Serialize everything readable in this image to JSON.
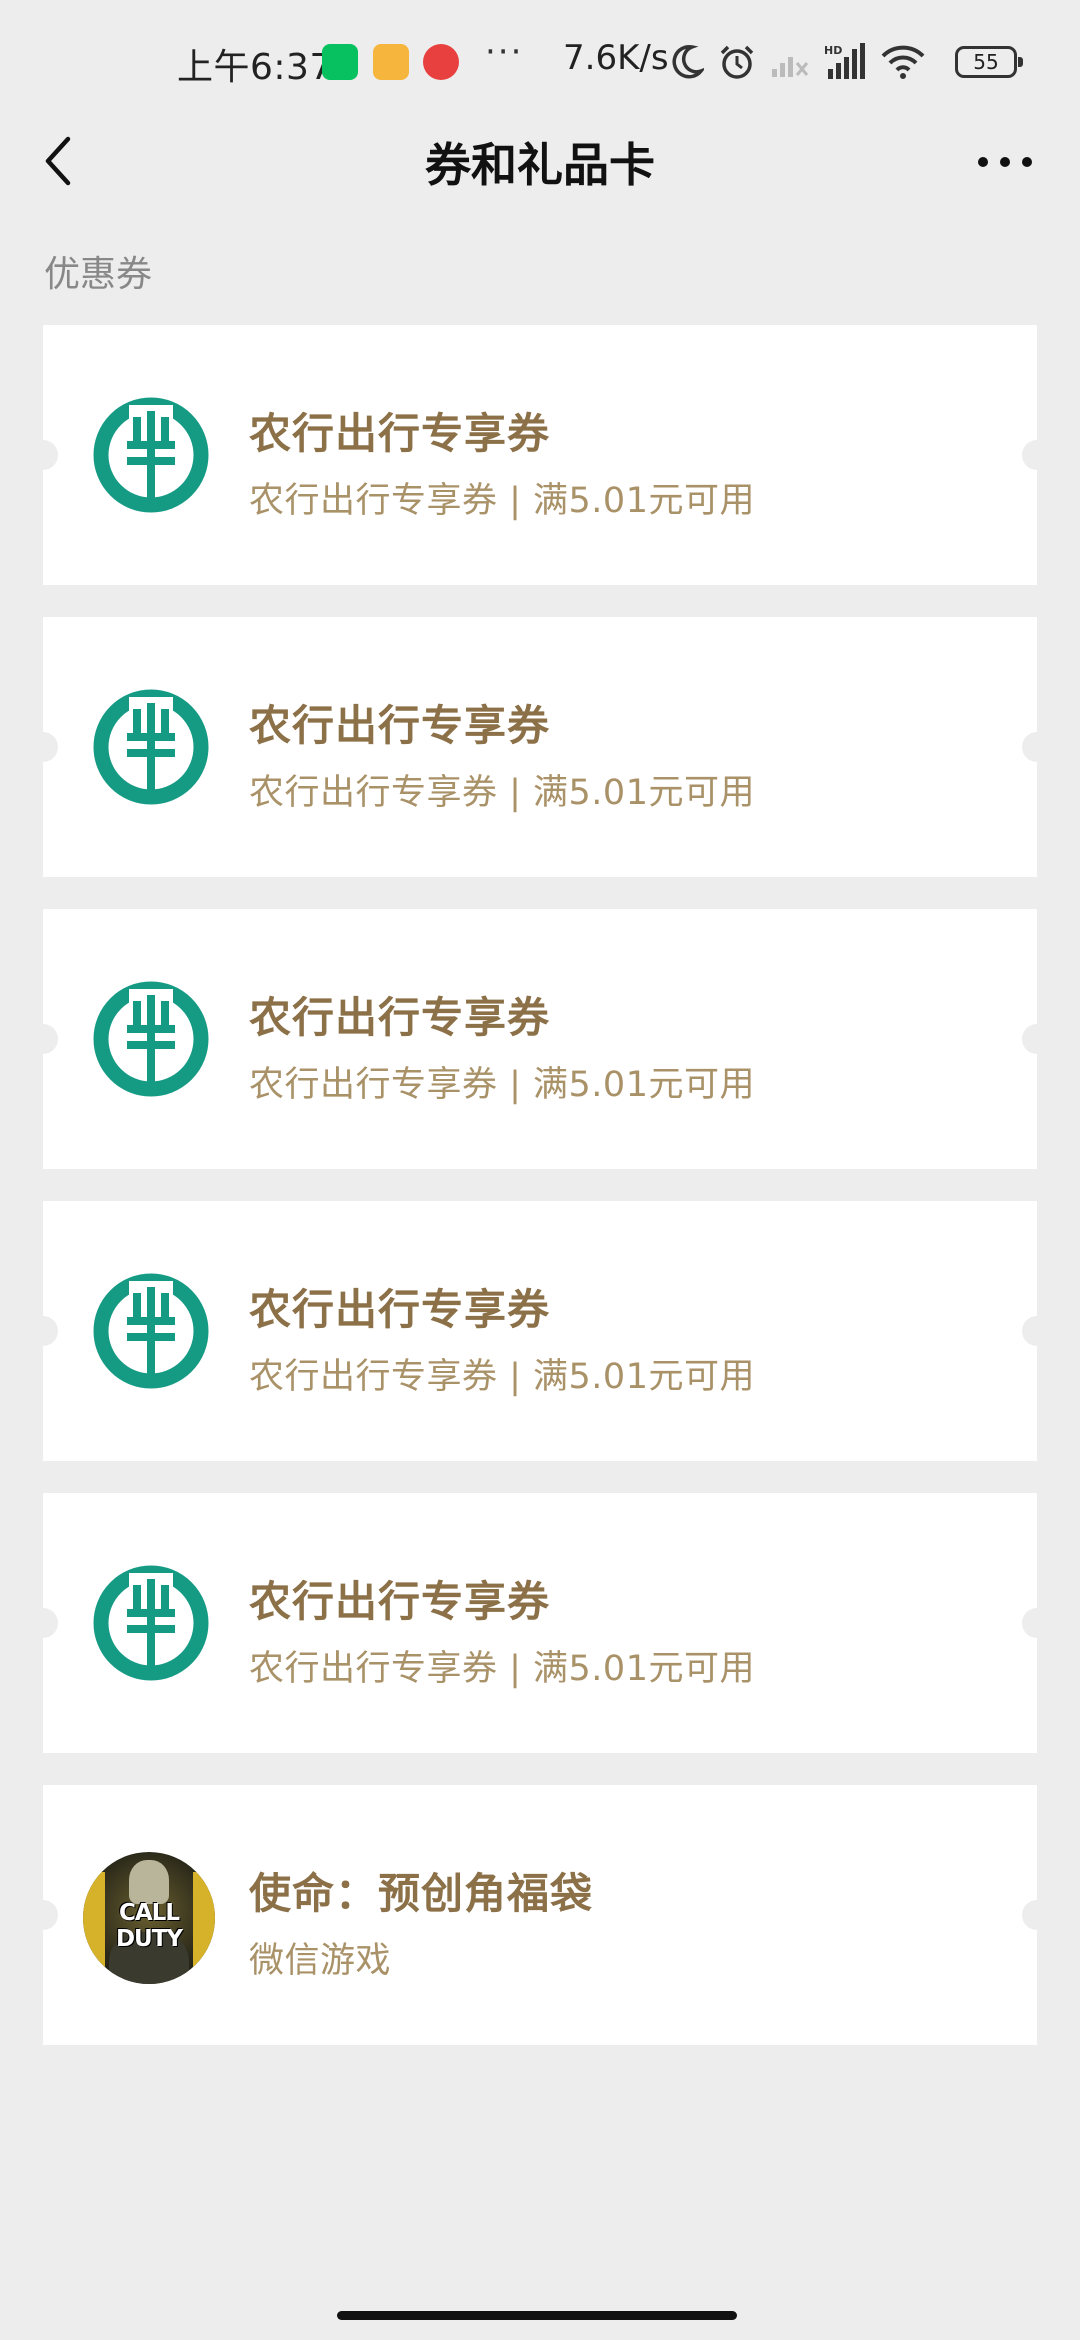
{
  "status_bar": {
    "time": "上午6:37",
    "more": "···",
    "net_speed": "7.6K/s",
    "signal_label": "HD",
    "battery": "55"
  },
  "nav": {
    "title": "券和礼品卡"
  },
  "section": {
    "label": "优惠券"
  },
  "coupons": [
    {
      "title": "农行出行专享券",
      "subtitle": "农行出行专享券 | 满5.01元可用",
      "icon": "abc-bank-logo-icon"
    },
    {
      "title": "农行出行专享券",
      "subtitle": "农行出行专享券 | 满5.01元可用",
      "icon": "abc-bank-logo-icon"
    },
    {
      "title": "农行出行专享券",
      "subtitle": "农行出行专享券 | 满5.01元可用",
      "icon": "abc-bank-logo-icon"
    },
    {
      "title": "农行出行专享券",
      "subtitle": "农行出行专享券 | 满5.01元可用",
      "icon": "abc-bank-logo-icon"
    },
    {
      "title": "农行出行专享券",
      "subtitle": "农行出行专享券 | 满5.01元可用",
      "icon": "abc-bank-logo-icon"
    }
  ],
  "gift": {
    "title": "使命：预创角福袋",
    "subtitle": "微信游戏",
    "logo_text": "CALL DUTY",
    "icon": "call-of-duty-logo-icon"
  },
  "colors": {
    "background": "#ededed",
    "card": "#ffffff",
    "title_gold": "#8b7048",
    "subtitle_gold": "#a99168",
    "bank_green": "#159b84"
  }
}
